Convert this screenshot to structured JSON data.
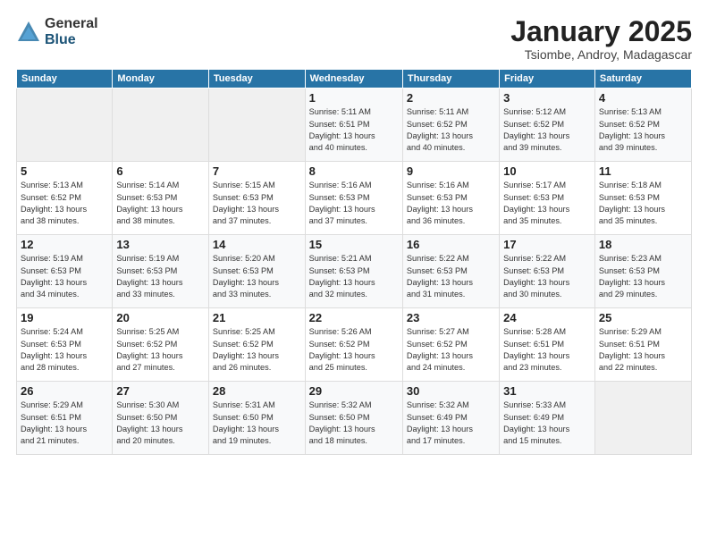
{
  "logo": {
    "general": "General",
    "blue": "Blue"
  },
  "header": {
    "month": "January 2025",
    "location": "Tsiombe, Androy, Madagascar"
  },
  "days_of_week": [
    "Sunday",
    "Monday",
    "Tuesday",
    "Wednesday",
    "Thursday",
    "Friday",
    "Saturday"
  ],
  "weeks": [
    [
      {
        "num": "",
        "info": ""
      },
      {
        "num": "",
        "info": ""
      },
      {
        "num": "",
        "info": ""
      },
      {
        "num": "1",
        "info": "Sunrise: 5:11 AM\nSunset: 6:51 PM\nDaylight: 13 hours\nand 40 minutes."
      },
      {
        "num": "2",
        "info": "Sunrise: 5:11 AM\nSunset: 6:52 PM\nDaylight: 13 hours\nand 40 minutes."
      },
      {
        "num": "3",
        "info": "Sunrise: 5:12 AM\nSunset: 6:52 PM\nDaylight: 13 hours\nand 39 minutes."
      },
      {
        "num": "4",
        "info": "Sunrise: 5:13 AM\nSunset: 6:52 PM\nDaylight: 13 hours\nand 39 minutes."
      }
    ],
    [
      {
        "num": "5",
        "info": "Sunrise: 5:13 AM\nSunset: 6:52 PM\nDaylight: 13 hours\nand 38 minutes."
      },
      {
        "num": "6",
        "info": "Sunrise: 5:14 AM\nSunset: 6:53 PM\nDaylight: 13 hours\nand 38 minutes."
      },
      {
        "num": "7",
        "info": "Sunrise: 5:15 AM\nSunset: 6:53 PM\nDaylight: 13 hours\nand 37 minutes."
      },
      {
        "num": "8",
        "info": "Sunrise: 5:16 AM\nSunset: 6:53 PM\nDaylight: 13 hours\nand 37 minutes."
      },
      {
        "num": "9",
        "info": "Sunrise: 5:16 AM\nSunset: 6:53 PM\nDaylight: 13 hours\nand 36 minutes."
      },
      {
        "num": "10",
        "info": "Sunrise: 5:17 AM\nSunset: 6:53 PM\nDaylight: 13 hours\nand 35 minutes."
      },
      {
        "num": "11",
        "info": "Sunrise: 5:18 AM\nSunset: 6:53 PM\nDaylight: 13 hours\nand 35 minutes."
      }
    ],
    [
      {
        "num": "12",
        "info": "Sunrise: 5:19 AM\nSunset: 6:53 PM\nDaylight: 13 hours\nand 34 minutes."
      },
      {
        "num": "13",
        "info": "Sunrise: 5:19 AM\nSunset: 6:53 PM\nDaylight: 13 hours\nand 33 minutes."
      },
      {
        "num": "14",
        "info": "Sunrise: 5:20 AM\nSunset: 6:53 PM\nDaylight: 13 hours\nand 33 minutes."
      },
      {
        "num": "15",
        "info": "Sunrise: 5:21 AM\nSunset: 6:53 PM\nDaylight: 13 hours\nand 32 minutes."
      },
      {
        "num": "16",
        "info": "Sunrise: 5:22 AM\nSunset: 6:53 PM\nDaylight: 13 hours\nand 31 minutes."
      },
      {
        "num": "17",
        "info": "Sunrise: 5:22 AM\nSunset: 6:53 PM\nDaylight: 13 hours\nand 30 minutes."
      },
      {
        "num": "18",
        "info": "Sunrise: 5:23 AM\nSunset: 6:53 PM\nDaylight: 13 hours\nand 29 minutes."
      }
    ],
    [
      {
        "num": "19",
        "info": "Sunrise: 5:24 AM\nSunset: 6:53 PM\nDaylight: 13 hours\nand 28 minutes."
      },
      {
        "num": "20",
        "info": "Sunrise: 5:25 AM\nSunset: 6:52 PM\nDaylight: 13 hours\nand 27 minutes."
      },
      {
        "num": "21",
        "info": "Sunrise: 5:25 AM\nSunset: 6:52 PM\nDaylight: 13 hours\nand 26 minutes."
      },
      {
        "num": "22",
        "info": "Sunrise: 5:26 AM\nSunset: 6:52 PM\nDaylight: 13 hours\nand 25 minutes."
      },
      {
        "num": "23",
        "info": "Sunrise: 5:27 AM\nSunset: 6:52 PM\nDaylight: 13 hours\nand 24 minutes."
      },
      {
        "num": "24",
        "info": "Sunrise: 5:28 AM\nSunset: 6:51 PM\nDaylight: 13 hours\nand 23 minutes."
      },
      {
        "num": "25",
        "info": "Sunrise: 5:29 AM\nSunset: 6:51 PM\nDaylight: 13 hours\nand 22 minutes."
      }
    ],
    [
      {
        "num": "26",
        "info": "Sunrise: 5:29 AM\nSunset: 6:51 PM\nDaylight: 13 hours\nand 21 minutes."
      },
      {
        "num": "27",
        "info": "Sunrise: 5:30 AM\nSunset: 6:50 PM\nDaylight: 13 hours\nand 20 minutes."
      },
      {
        "num": "28",
        "info": "Sunrise: 5:31 AM\nSunset: 6:50 PM\nDaylight: 13 hours\nand 19 minutes."
      },
      {
        "num": "29",
        "info": "Sunrise: 5:32 AM\nSunset: 6:50 PM\nDaylight: 13 hours\nand 18 minutes."
      },
      {
        "num": "30",
        "info": "Sunrise: 5:32 AM\nSunset: 6:49 PM\nDaylight: 13 hours\nand 17 minutes."
      },
      {
        "num": "31",
        "info": "Sunrise: 5:33 AM\nSunset: 6:49 PM\nDaylight: 13 hours\nand 15 minutes."
      },
      {
        "num": "",
        "info": ""
      }
    ]
  ]
}
